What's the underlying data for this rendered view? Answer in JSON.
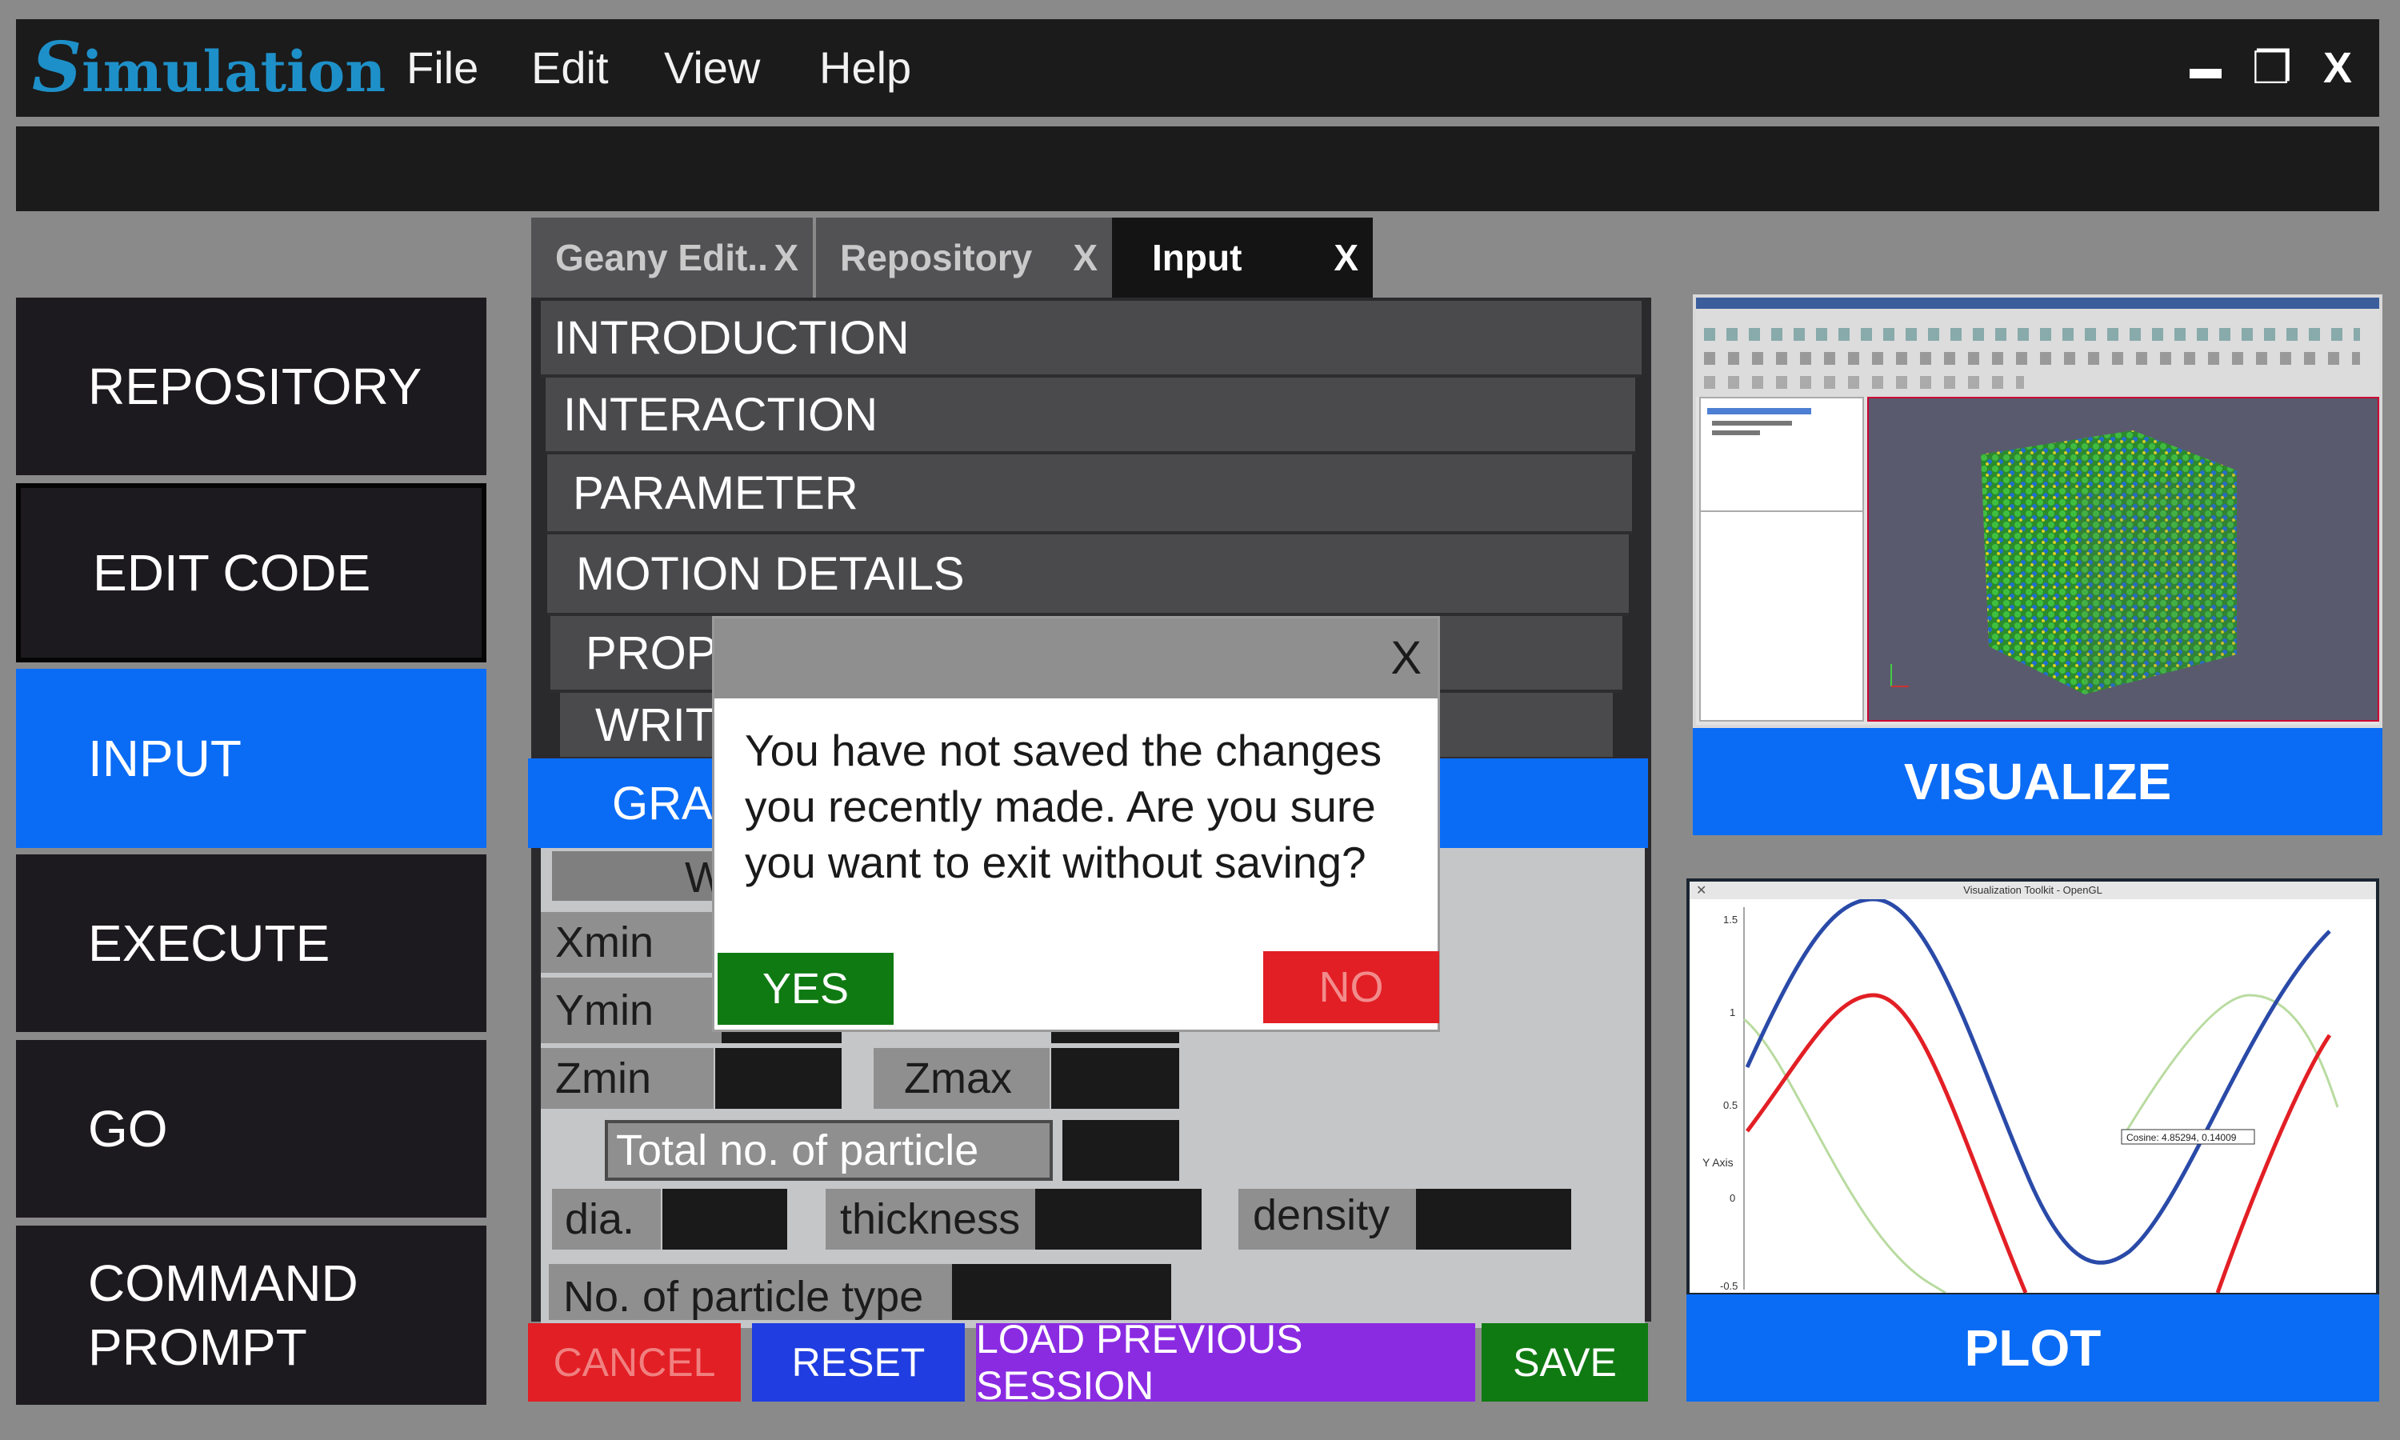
{
  "app": {
    "logo_first": "S",
    "logo_rest": "imulation",
    "menu": [
      "File",
      "Edit",
      "View",
      "Help"
    ],
    "window_controls": {
      "minimize": "▬",
      "maximize": "❐",
      "close": "X"
    }
  },
  "sidebar": {
    "items": [
      {
        "label": "REPOSITORY"
      },
      {
        "label": "EDIT CODE"
      },
      {
        "label": "INPUT"
      },
      {
        "label": "EXECUTE"
      },
      {
        "label": "GO"
      },
      {
        "label": "COMMAND PROMPT"
      }
    ],
    "active": "INPUT"
  },
  "tabs": [
    {
      "label": "Geany Edit..",
      "close": "X"
    },
    {
      "label": "Repository",
      "close": "X"
    },
    {
      "label": "Input",
      "close": "X",
      "active": true
    }
  ],
  "sections": [
    {
      "label": "INTRODUCTION"
    },
    {
      "label": "INTERACTION"
    },
    {
      "label": "PARAMETER"
    },
    {
      "label": "MOTION DETAILS"
    },
    {
      "label": "PROP"
    },
    {
      "label": "WRIT"
    },
    {
      "label": "GRAI"
    }
  ],
  "form": {
    "sub_header": "W",
    "xmin": "Xmin",
    "ymin": "Ymin",
    "zmin": "Zmin",
    "zmax": "Zmax",
    "total_particle": "Total no. of particle",
    "dia": "dia.",
    "thickness": "thickness",
    "density": "density",
    "particle_type": "No. of particle type"
  },
  "buttons": {
    "cancel": "CANCEL",
    "reset": "RESET",
    "load": "LOAD PREVIOUS SESSION",
    "save": "SAVE"
  },
  "right": {
    "visualize": "VISUALIZE",
    "plot": "PLOT",
    "plot_window_title": "Visualization Toolkit - OpenGL",
    "plot_ylabel": "Y Axis",
    "plot_ticks": [
      "1.5",
      "1",
      "0.5",
      "0",
      "-0.5"
    ],
    "plot_tooltip": "Cosine: 4.85294, 0.14009"
  },
  "dialog": {
    "close": "X",
    "message": "You have not saved the changes you recently made. Are you sure you want to exit without saving?",
    "yes": "YES",
    "no": "NO"
  },
  "colors": {
    "accent": "#0a6cf5",
    "dark": "#1b1b1b",
    "yes": "#0f7a12",
    "no": "#e21f25",
    "save": "#0f7a12",
    "load": "#8a2be2",
    "reset": "#1f3de0",
    "cancel": "#e21f25"
  }
}
